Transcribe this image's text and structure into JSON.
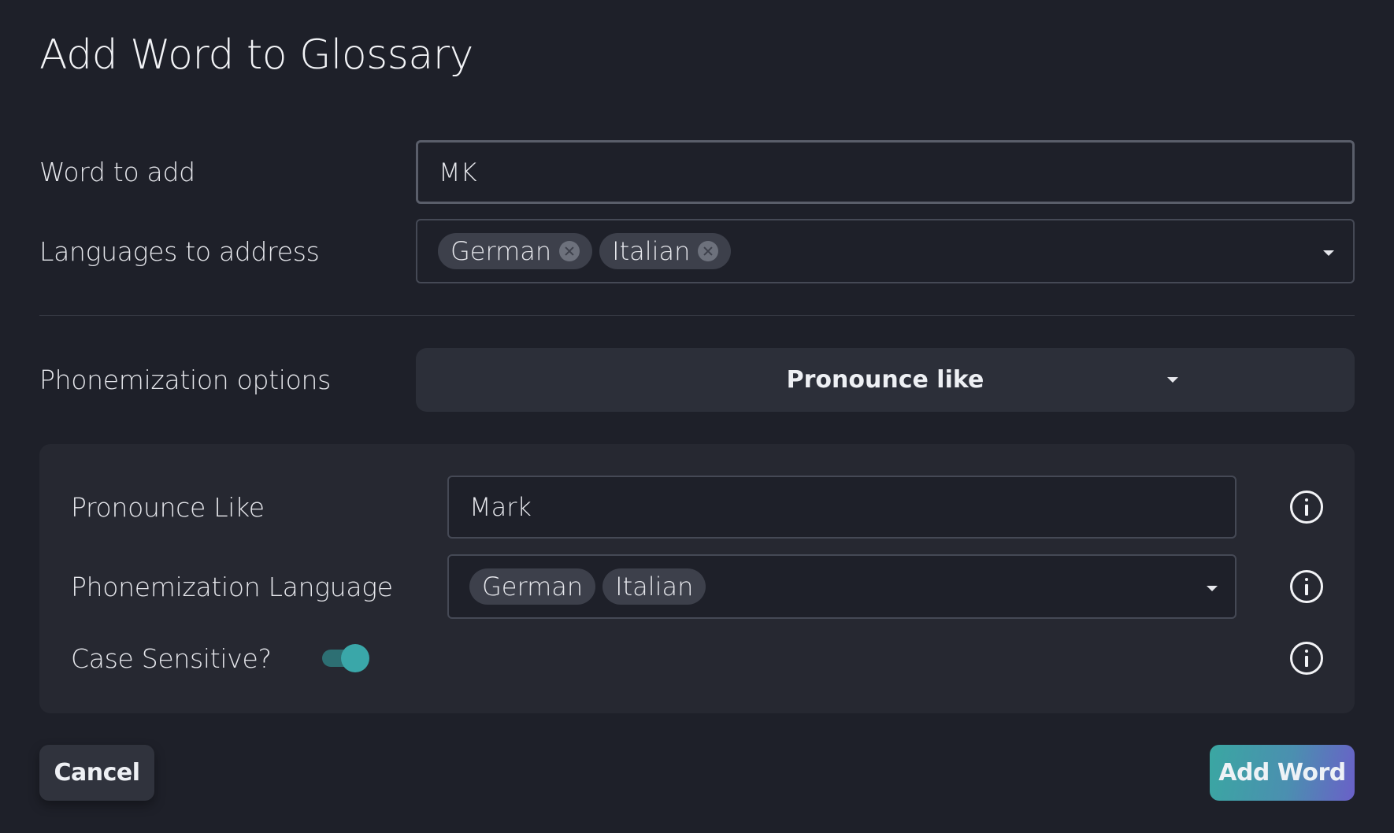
{
  "dialog": {
    "title": "Add Word to Glossary"
  },
  "word_field": {
    "label": "Word to add",
    "value": "MK"
  },
  "languages_field": {
    "label": "Languages to address",
    "chips": [
      "German",
      "Italian"
    ]
  },
  "phonemization": {
    "label": "Phonemization options",
    "selected": "Pronounce like"
  },
  "panel": {
    "pronounce_like": {
      "label": "Pronounce Like",
      "value": "Mark"
    },
    "phonemization_language": {
      "label": "Phonemization Language",
      "chips": [
        "German",
        "Italian"
      ]
    },
    "case_sensitive": {
      "label": "Case Sensitive?",
      "enabled": true
    }
  },
  "footer": {
    "cancel_label": "Cancel",
    "add_label": "Add Word"
  },
  "colors": {
    "background": "#1e2029",
    "panel": "#262831",
    "accent_teal": "#3aa7a9",
    "accent_purple": "#6a60c8"
  },
  "icons": {
    "info": "info-icon",
    "chip_remove": "close-circle-icon",
    "dropdown": "caret-down-icon"
  }
}
